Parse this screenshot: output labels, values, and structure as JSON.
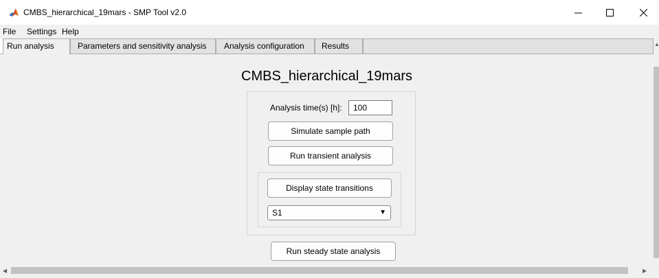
{
  "window": {
    "title": "CMBS_hierarchical_19mars - SMP Tool v2.0",
    "icon": "matlab-icon",
    "controls": {
      "minimize": "minimize-icon",
      "maximize": "maximize-icon",
      "close": "close-icon"
    }
  },
  "menu": {
    "items": [
      "File",
      "Settings",
      "Help"
    ]
  },
  "tabs": [
    {
      "label": "Run analysis",
      "active": true
    },
    {
      "label": "Parameters and sensitivity analysis",
      "active": false
    },
    {
      "label": "Analysis configuration",
      "active": false
    },
    {
      "label": "Results",
      "active": false
    }
  ],
  "main": {
    "heading": "CMBS_hierarchical_19mars",
    "analysis_time_label": "Analysis time(s) [h]:",
    "analysis_time_value": "100",
    "simulate_button": "Simulate sample path",
    "transient_button": "Run transient analysis",
    "display_transitions_button": "Display state transitions",
    "state_select": {
      "selected": "S1",
      "arrow": "▼"
    },
    "steady_state_button": "Run steady state analysis"
  },
  "colors": {
    "window_bg": "#f0f0f0",
    "tab_inactive": "#e2e2e2",
    "border": "#adadad"
  }
}
